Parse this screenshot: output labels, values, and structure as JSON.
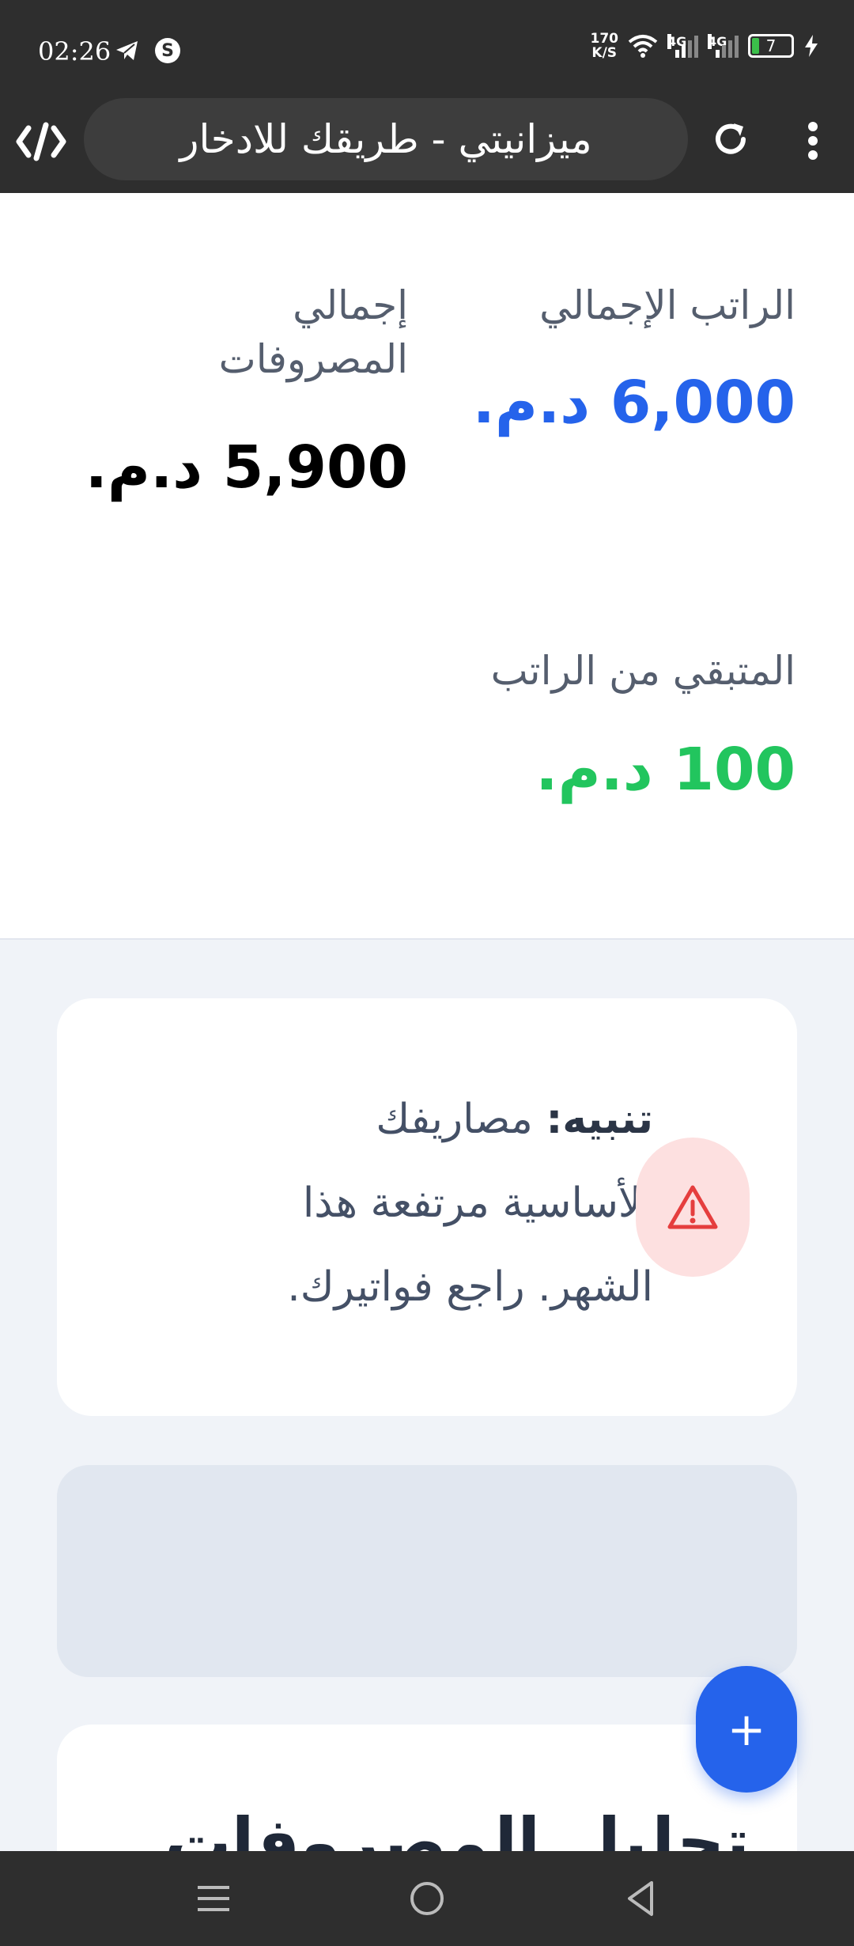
{
  "status_bar": {
    "time": "02:26",
    "net_speed_value": "170",
    "net_speed_unit": "K/S",
    "sim1_label": "4G",
    "sim2_label": "4G",
    "battery_level": "7"
  },
  "browser": {
    "title": "ميزانيتي - طريقك للادخار"
  },
  "summary": {
    "salary_label": "الراتب الإجمالي",
    "salary_value": "6,000 د.م.",
    "expenses_label": "إجمالي المصروفات",
    "expenses_value": "5,900 د.م.",
    "remaining_label": "المتبقي من الراتب",
    "remaining_value": "100 د.م."
  },
  "alert": {
    "prefix": "تنبيه:",
    "message": " مصاريفك الأساسية مرتفعة هذا الشهر. راجع فواتيرك."
  },
  "analysis": {
    "title": "تحليل المصروفات"
  },
  "fab": {
    "label": "+"
  },
  "colors": {
    "salary": "#2563eb",
    "expenses": "#000000",
    "remaining": "#22c55e",
    "alert_icon": "#e53e3e",
    "fab": "#2563eb"
  },
  "icons": {
    "telegram": "telegram-icon",
    "app": "s-app-icon",
    "wifi": "wifi-icon",
    "charging": "charging-icon",
    "code": "code-icon",
    "reload": "reload-icon",
    "menu": "overflow-menu-icon",
    "warning": "warning-icon",
    "nav_menu": "recents-icon",
    "nav_home": "home-icon",
    "nav_back": "back-icon"
  }
}
